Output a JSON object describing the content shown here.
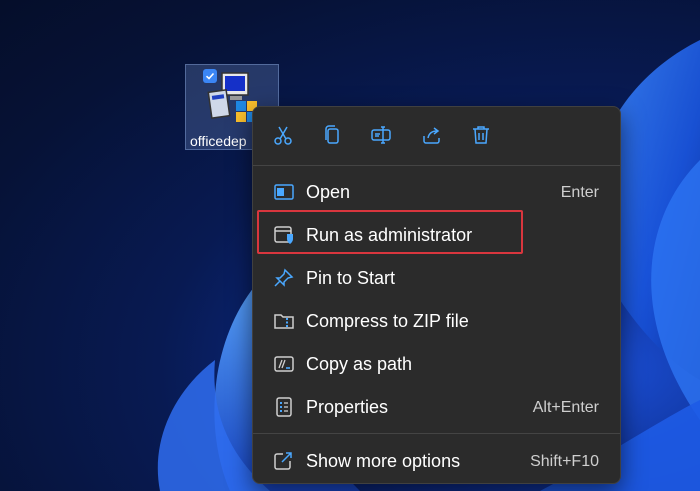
{
  "desktop": {
    "file_icon_label": "officedep",
    "file_icon": "installer-setup-icon"
  },
  "context_menu": {
    "toolbar": [
      {
        "icon": "cut-icon"
      },
      {
        "icon": "copy-icon"
      },
      {
        "icon": "rename-icon"
      },
      {
        "icon": "share-icon"
      },
      {
        "icon": "delete-icon"
      }
    ],
    "items": [
      {
        "label": "Open",
        "shortcut": "Enter",
        "icon": "open-window-icon"
      },
      {
        "label": "Run as administrator",
        "shortcut": "",
        "icon": "shield-window-icon"
      },
      {
        "label": "Pin to Start",
        "shortcut": "",
        "icon": "pin-icon"
      },
      {
        "label": "Compress to ZIP file",
        "shortcut": "",
        "icon": "zip-folder-icon"
      },
      {
        "label": "Copy as path",
        "shortcut": "",
        "icon": "copy-path-icon"
      },
      {
        "label": "Properties",
        "shortcut": "Alt+Enter",
        "icon": "properties-icon"
      },
      {
        "label": "Show more options",
        "shortcut": "Shift+F10",
        "icon": "more-options-icon"
      }
    ]
  },
  "colors": {
    "menu_bg": "#2b2b2b",
    "accent": "#4aa8ff",
    "highlight_border": "#d9363e"
  }
}
